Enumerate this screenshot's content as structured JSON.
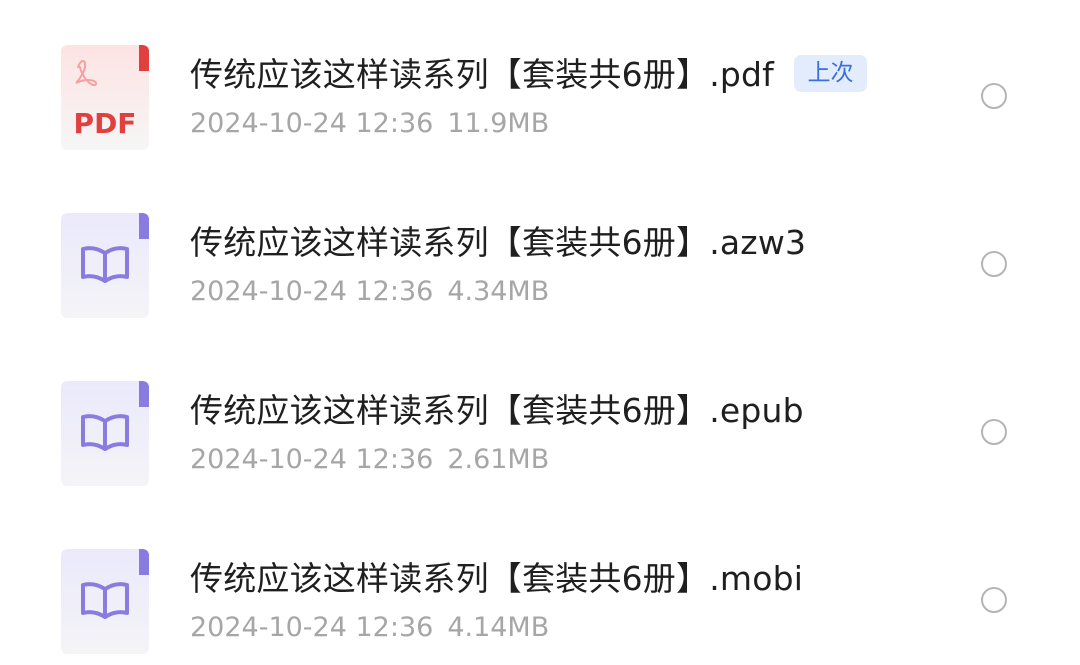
{
  "files": [
    {
      "name": "传统应该这样读系列【套装共6册】.pdf",
      "date": "2024-10-24 12:36",
      "size": "11.9MB",
      "icon": "pdf-file-icon",
      "icon_label": "PDF",
      "badge": "上次"
    },
    {
      "name": "传统应该这样读系列【套装共6册】.azw3",
      "date": "2024-10-24 12:36",
      "size": "4.34MB",
      "icon": "ebook-file-icon"
    },
    {
      "name": "传统应该这样读系列【套装共6册】.epub",
      "date": "2024-10-24 12:36",
      "size": "2.61MB",
      "icon": "ebook-file-icon"
    },
    {
      "name": "传统应该这样读系列【套装共6册】.mobi",
      "date": "2024-10-24 12:36",
      "size": "4.14MB",
      "icon": "ebook-file-icon"
    }
  ],
  "colors": {
    "pdf_accent": "#e0413f",
    "ebook_accent": "#8a7be0",
    "badge_text": "#3a6fe0",
    "badge_bg": "#e3ecfd"
  }
}
